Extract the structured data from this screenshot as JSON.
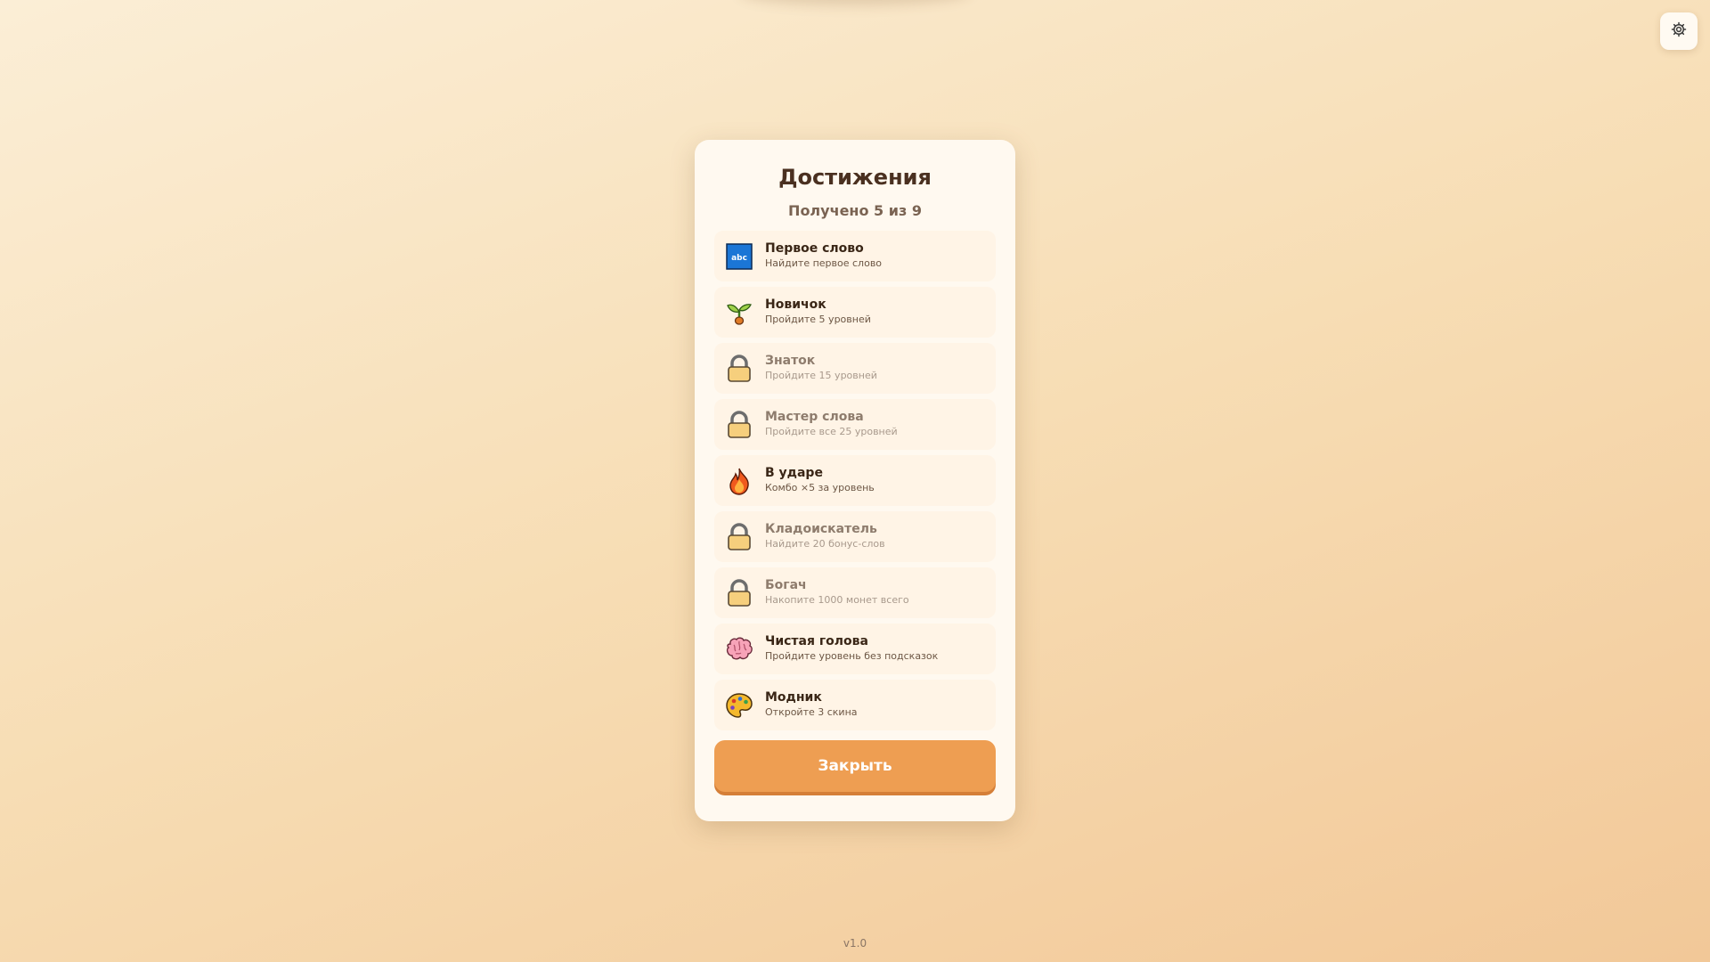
{
  "settings": {
    "icon": "gear-icon"
  },
  "modal": {
    "title": "Достижения",
    "subtitle": "Получено 5 из 9",
    "close_label": "Закрыть"
  },
  "achievements": [
    {
      "name": "Первое слово",
      "desc": "Найдите первое слово",
      "icon": "abc-icon",
      "icon_text": "abc",
      "locked": false
    },
    {
      "name": "Новичок",
      "desc": "Пройдите 5 уровней",
      "icon": "seedling-icon",
      "locked": false
    },
    {
      "name": "Знаток",
      "desc": "Пройдите 15 уровней",
      "icon": "lock-icon",
      "locked": true
    },
    {
      "name": "Мастер слова",
      "desc": "Пройдите все 25 уровней",
      "icon": "lock-icon",
      "locked": true
    },
    {
      "name": "В ударе",
      "desc": "Комбо ×5 за уровень",
      "icon": "fire-icon",
      "locked": false
    },
    {
      "name": "Кладоискатель",
      "desc": "Найдите 20 бонус-слов",
      "icon": "lock-icon",
      "locked": true
    },
    {
      "name": "Богач",
      "desc": "Накопите 1000 монет всего",
      "icon": "lock-icon",
      "locked": true
    },
    {
      "name": "Чистая голова",
      "desc": "Пройдите уровень без подсказок",
      "icon": "brain-icon",
      "locked": false
    },
    {
      "name": "Модник",
      "desc": "Откройте 3 скина",
      "icon": "palette-icon",
      "locked": false
    }
  ],
  "footer": {
    "version": "v1.0"
  },
  "colors": {
    "accent": "#ee9e52",
    "accent_shadow": "#d57f38",
    "panel": "#fff9f0",
    "title_text": "#4a3020"
  }
}
